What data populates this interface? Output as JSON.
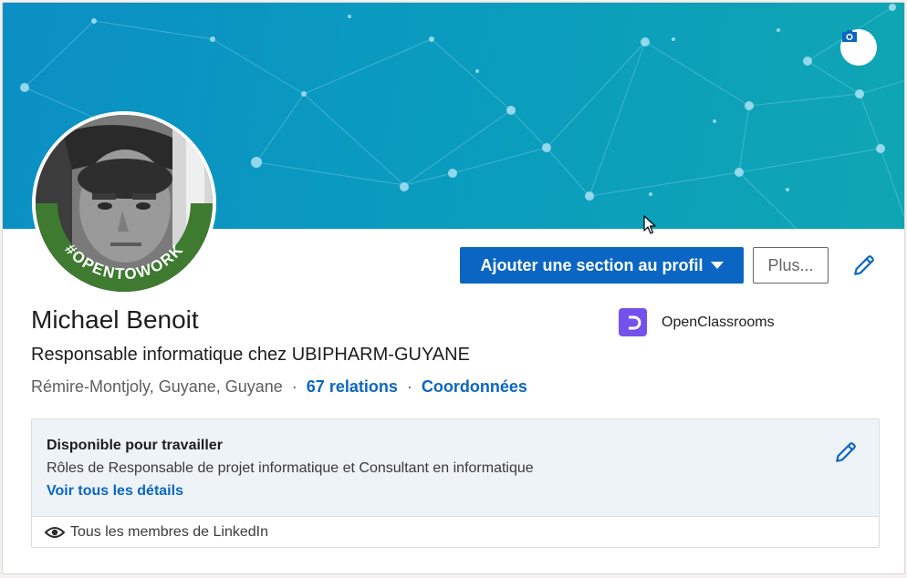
{
  "banner": {
    "colors": {
      "start": "#0b8fc4",
      "end": "#0fa6b3",
      "nodes": "#8fd8ee"
    },
    "camera_icon": "camera-icon"
  },
  "profile": {
    "name": "Michael Benoit",
    "headline": "Responsable informatique chez UBIPHARM-GUYANE",
    "location": "Rémire-Montjoly, Guyane, Guyane",
    "separator": "·",
    "relations": "67 relations",
    "contact": "Coordonnées",
    "frame_text": "#OPENTOWORK",
    "company": {
      "name": "OpenClassrooms",
      "logo_color": "#7451eb"
    }
  },
  "actions": {
    "add_section": "Ajouter une section au profil",
    "more": "Plus...",
    "edit_icon": "pencil-icon"
  },
  "open_to_work": {
    "title": "Disponible pour travailler",
    "description": "Rôles de Responsable de projet informatique et Consultant en informatique",
    "details_link": "Voir tous les détails",
    "visibility": "Tous les membres de LinkedIn",
    "visibility_icon": "eye-icon"
  },
  "colors": {
    "accent": "#0a66c2",
    "otw_green": "#3e7a2f"
  }
}
